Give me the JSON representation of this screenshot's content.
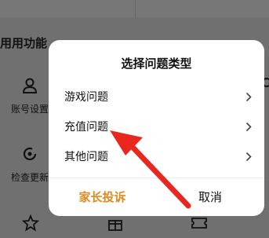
{
  "background": {
    "section_title": "用用功能",
    "items": [
      {
        "label": "账号设置",
        "icon": "user-icon"
      },
      {
        "label": "检查更新",
        "icon": "update-icon"
      }
    ],
    "bottom_icons": [
      "badge-icon",
      "gift-icon",
      "ticket-icon"
    ]
  },
  "dialog": {
    "title": "选择问题类型",
    "options": [
      {
        "label": "游戏问题"
      },
      {
        "label": "充值问题"
      },
      {
        "label": "其他问题"
      }
    ],
    "parent_complaint_label": "家长投诉",
    "cancel_label": "取消"
  },
  "colors": {
    "accent": "#e08a1e",
    "arrow": "#e8281e",
    "overlay": "#707070"
  }
}
